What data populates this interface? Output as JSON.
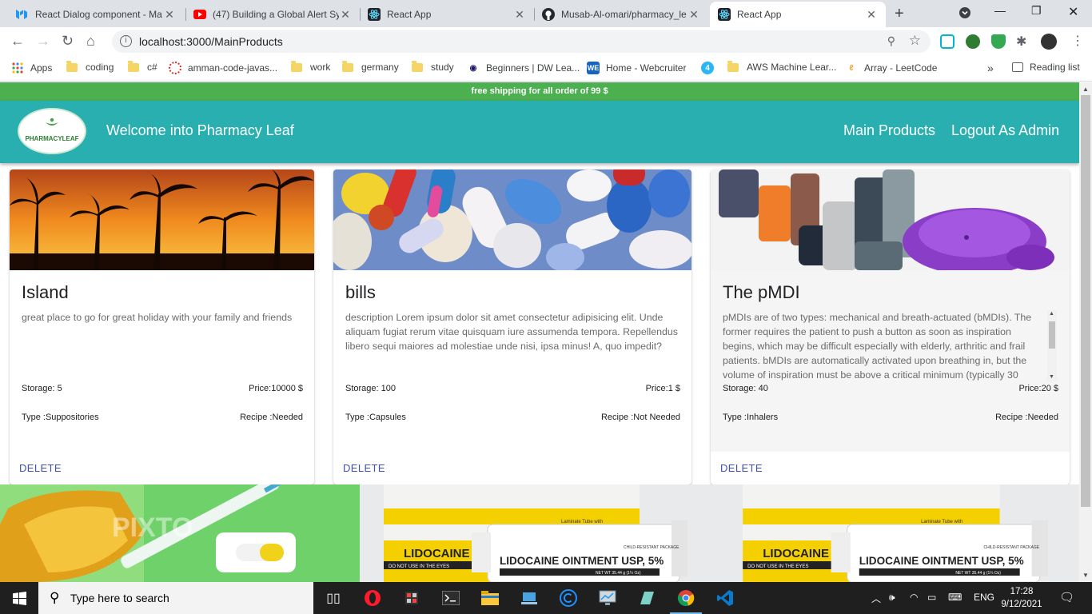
{
  "browser": {
    "tabs": [
      {
        "title": "React Dialog component - Ma",
        "favicon_color": "#2196f3"
      },
      {
        "title": "(47) Building a Global Alert Sy",
        "favicon_color": "#ff0000"
      },
      {
        "title": "React App",
        "favicon_color": "#61dafb"
      },
      {
        "title": "Musab-Al-omari/pharmacy_le",
        "favicon_color": "#24292e"
      },
      {
        "title": "React App",
        "favicon_color": "#61dafb",
        "active": true
      }
    ],
    "url": "localhost:3000/MainProducts",
    "bookmarks": [
      {
        "label": "Apps"
      },
      {
        "label": "coding"
      },
      {
        "label": "c#"
      },
      {
        "label": "amman-code-javas..."
      },
      {
        "label": "work"
      },
      {
        "label": "germany"
      },
      {
        "label": "study"
      },
      {
        "label": "Beginners | DW Lea..."
      },
      {
        "label": "Home - Webcruiter"
      },
      {
        "label": "AWS Machine Lear..."
      },
      {
        "label": "Array - LeetCode"
      }
    ],
    "more_bookmarks": "»",
    "reading_list": "Reading list"
  },
  "page": {
    "promo": "free shipping for all order of 99 $",
    "logo_text": "PHARMACYLEAF",
    "welcome": "Welcome into Pharmacy Leaf",
    "nav": {
      "main_products": "Main Products",
      "logout": "Logout As Admin"
    },
    "products": [
      {
        "title": "Island",
        "description": "great place to go for great holiday with your family and friends",
        "storage": "Storage: 5",
        "price": "Price:10000 $",
        "type": "Type :Suppositories",
        "recipe": "Recipe :Needed",
        "delete_label": "DELETE"
      },
      {
        "title": "bills",
        "description": "description Lorem ipsum dolor sit amet consectetur adipisicing elit. Unde aliquam fugiat rerum vitae quisquam iure assumenda tempora. Repellendus libero sequi maiores ad molestiae unde nisi, ipsa minus! A, quo impedit?",
        "storage": "Storage: 100",
        "price": "Price:1 $",
        "type": "Type :Capsules",
        "recipe": "Recipe :Not Needed",
        "delete_label": "DELETE"
      },
      {
        "title": "The pMDI",
        "description": "pMDIs are of two types: mechanical and breath-actuated (bMDIs). The former requires the patient to push a button as soon as inspiration begins, which may be difficult especially with elderly, arthritic and frail patients. bMDIs are automatically activated upon breathing in, but the volume of inspiration must be above a critical minimum (typically 30",
        "storage": "Storage: 40",
        "price": "Price:20 $",
        "type": "Type :Inhalers",
        "recipe": "Recipe :Needed",
        "delete_label": "DELETE"
      }
    ],
    "bottom_images": [
      {
        "watermark": "PIXTO"
      },
      {
        "product_text": "LIDOCAINE OINTMENT USP, 5%",
        "box_text": "LIDOCAINE OINT",
        "box_subtext": "DO NOT USE IN THE EYES",
        "tube_subtext": "CHILD-RESISTANT PACKAGE",
        "tube_side_text": "NET WT 35.44 g (1¼ Oz)",
        "box_top_text": "Laminate Tube with"
      },
      {
        "product_text": "LIDOCAINE OINTMENT USP, 5%",
        "box_text": "LIDOCAINE OINT",
        "box_subtext": "DO NOT USE IN THE EYES",
        "tube_subtext": "CHILD-RESISTANT PACKAGE",
        "tube_side_text": "NET WT 35.44 g (1¼ Oz)",
        "box_top_text": "Laminate Tube with"
      }
    ]
  },
  "taskbar": {
    "search_placeholder": "Type here to search",
    "language": "ENG",
    "time": "17:28",
    "date": "9/12/2021"
  }
}
